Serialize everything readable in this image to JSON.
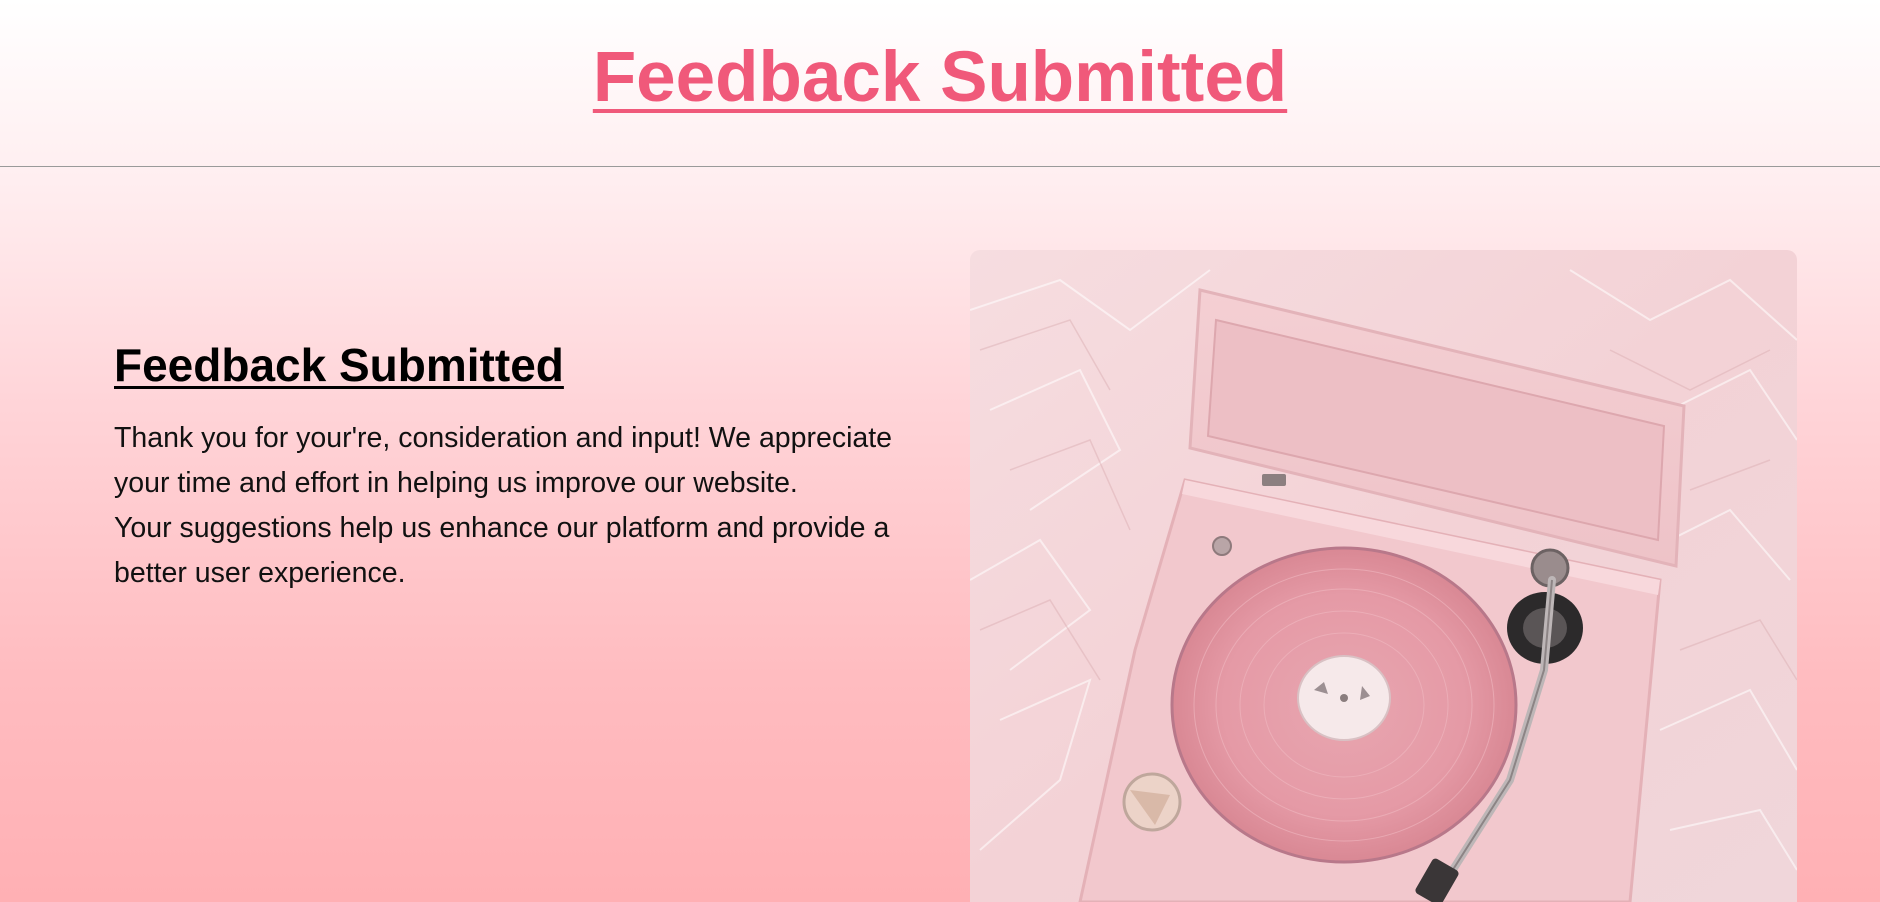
{
  "header": {
    "title": "Feedback Submitted"
  },
  "main": {
    "heading": "Feedback Submitted",
    "paragraph_1": "Thank you for your're, consideration and input! We appreciate your time and effort in helping us improve our website.",
    "paragraph_2": "Your suggestions help us enhance our platform and provide a better user experience."
  },
  "image": {
    "subject": "pink-record-player-photo"
  },
  "colors": {
    "title_pink": "#f0597a",
    "background_top": "#ffffff",
    "background_bottom": "#ffb0b4"
  }
}
